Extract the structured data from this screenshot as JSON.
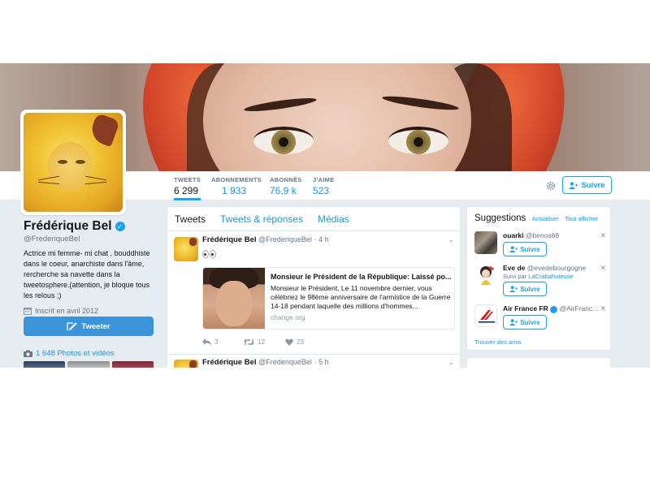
{
  "profile": {
    "name": "Frédérique Bel",
    "handle": "@FrederiqueBel",
    "bio": "Actrice mi femme- mi chat , bouddhiste dans le coeur, anarchiste dans l'âme, rercherche sa navette dans la tweetosphere.(attention, je bloque tous les relous ;)",
    "joined": "Inscrit en avril 2012",
    "tweet_button": "Tweeter",
    "photos_link": "1 648 Photos et vidéos"
  },
  "stats": [
    {
      "label": "TWEETS",
      "value": "6 299"
    },
    {
      "label": "ABONNEMENTS",
      "value": "1 933"
    },
    {
      "label": "ABONNÉS",
      "value": "76,9 k"
    },
    {
      "label": "J'AIME",
      "value": "523"
    }
  ],
  "header": {
    "follow_label": "Suivre",
    "settings_icon": "gear-icon"
  },
  "timeline": {
    "tabs": [
      "Tweets",
      "Tweets & réponses",
      "Médias"
    ],
    "tweets": [
      {
        "name": "Frédérique Bel",
        "handle": "@FrederiqueBel",
        "time": "4 h",
        "card": {
          "title": "Monsieur le Président de la République: Laissé po...",
          "description": "Monsieur le Président, Le 11 novembre dernier, vous célébriez le 98ème anniversaire de l'armistice de la Guerre 14-18 pendant laquelle des millions d'hommes...",
          "domain": "change.org"
        },
        "replies": "3",
        "retweets": "12",
        "likes": "23"
      },
      {
        "name": "Frédérique Bel",
        "handle": "@FrederiqueBel",
        "time": "5 h"
      }
    ]
  },
  "suggestions": {
    "title": "Suggestions",
    "refresh": "Actualiser",
    "show_all": "Tout afficher",
    "follow_label": "Suivre",
    "items": [
      {
        "name": "ouarki",
        "handle": "@benos68",
        "sub_prefix": "",
        "sub_link": ""
      },
      {
        "name": "Eve de",
        "handle": "@evedebourgogne",
        "sub_prefix": "Suivi par ",
        "sub_link": "LaCrabahuteuse"
      },
      {
        "name": "Air France FR",
        "handle": "@AirFranc...",
        "sub_prefix": "",
        "sub_link": ""
      }
    ],
    "find_friends": "Trouver des amis"
  },
  "colors": {
    "accent": "#1da1f2",
    "link": "#1b95e0",
    "tweet_button": "#3b94d9",
    "background": "#e6ecf0"
  }
}
